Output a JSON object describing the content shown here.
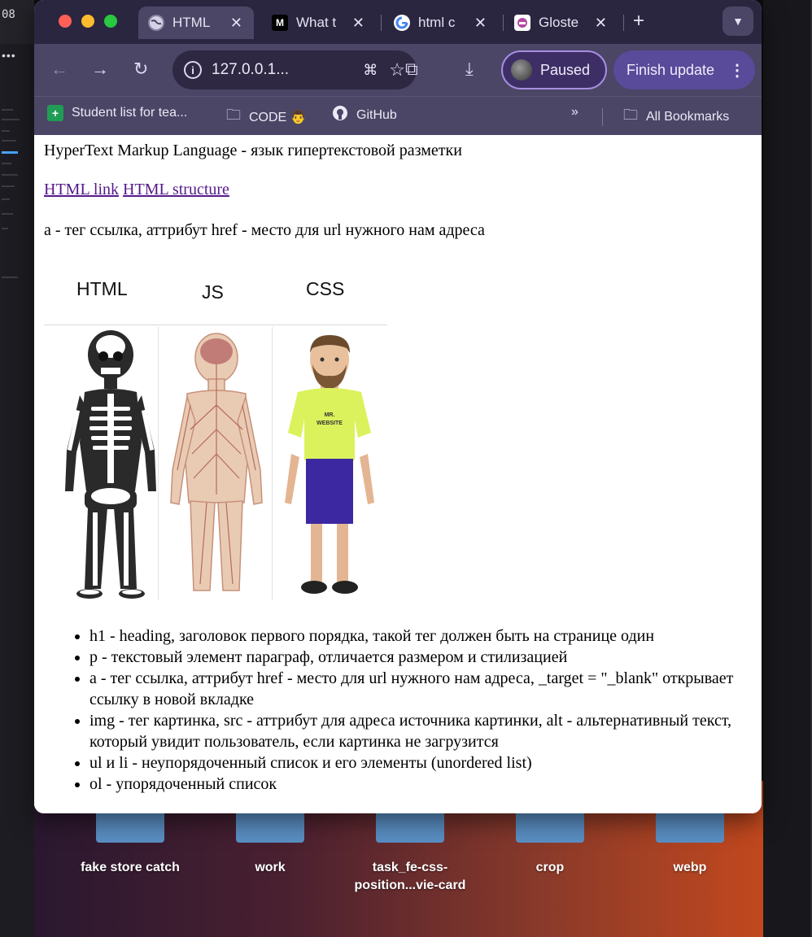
{
  "editor": {
    "number": "08",
    "dots": "•••"
  },
  "tabs": [
    {
      "title": "HTML",
      "favicon": "globe-icon",
      "active": true
    },
    {
      "title": "What t",
      "favicon": "medium-icon",
      "active": false
    },
    {
      "title": "html c",
      "favicon": "google-icon",
      "active": false
    },
    {
      "title": "Gloste",
      "favicon": "glossary-icon",
      "active": false
    }
  ],
  "medium_favicon_text": "M",
  "toolbar": {
    "url": "127.0.0.1...",
    "profile_label": "Paused",
    "update_label": "Finish update"
  },
  "bookmarks": [
    {
      "label": "Student list for tea...",
      "icon": "sheets-icon"
    },
    {
      "label": "CODE 👨",
      "icon": "folder-icon"
    },
    {
      "label": "GitHub",
      "icon": "github-icon"
    }
  ],
  "bookmarks_all": "All Bookmarks",
  "page": {
    "intro": "HyperText Markup Language - язык гипертекстовой разметки",
    "link1": "HTML link",
    "link2": "HTML structure",
    "a_desc": "a - тег ссылка, аттрибут href - место для url нужного нам адреса",
    "figure": {
      "col1": "HTML",
      "col2": "JS",
      "col3": "CSS",
      "shirt_line1": "MR.",
      "shirt_line2": "WEBSITE"
    },
    "list": [
      "h1 - heading, заголовок первого порядка, такой тег должен быть на странице один",
      "p - текстовый элемент параграф, отличается размером и стилизацией",
      "a - тег ссылка, аттрибут href - место для url нужного нам адреса, _target = \"_blank\" открывает ссылку в новой вкладке",
      "img - тег картинка, src - аттрибут для адреса источника картинки, alt - альтернативный текст, который увидит пользователь, если картинка не загрузится",
      "ul и li - неупорядоченный список и его элементы (unordered list)",
      "ol - упорядоченный список"
    ]
  },
  "desktop_folders": [
    {
      "label": "fake store catch"
    },
    {
      "label": "work"
    },
    {
      "label": "task_fe-css-position...vie-card"
    },
    {
      "label": "crop"
    },
    {
      "label": "webp"
    }
  ],
  "colors": {
    "tabbar": "#2b2640",
    "toolbar": "#4b4566",
    "link": "#551a8b",
    "close": "#ff5f57",
    "minimize": "#febc2e",
    "zoom": "#28c840"
  }
}
